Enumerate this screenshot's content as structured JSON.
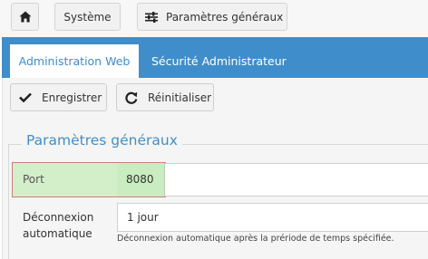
{
  "breadcrumb": {
    "home_icon": "home-icon",
    "items": [
      {
        "label": "Système"
      },
      {
        "label": "Paramètres généraux",
        "icon": "sliders-icon"
      }
    ]
  },
  "tabs": [
    {
      "label": "Administration Web",
      "active": true
    },
    {
      "label": "Sécurité Administrateur",
      "active": false
    }
  ],
  "toolbar": {
    "save_label": "Enregistrer",
    "save_icon": "checkmark-icon",
    "reset_label": "Réinitialiser",
    "reset_icon": "refresh-icon"
  },
  "section": {
    "legend": "Paramètres généraux",
    "fields": {
      "port": {
        "label": "Port",
        "value": "8080"
      },
      "timeout": {
        "label_line1": "Déconnexion",
        "label_line2": "automatique",
        "value": "1 jour",
        "help": "Déconnexion automatique après la prériode de temps spécifiée."
      }
    }
  },
  "colors": {
    "accent": "#3f8ecb",
    "highlight_bg": "#d3efca",
    "highlight_border": "#d47a7a"
  }
}
